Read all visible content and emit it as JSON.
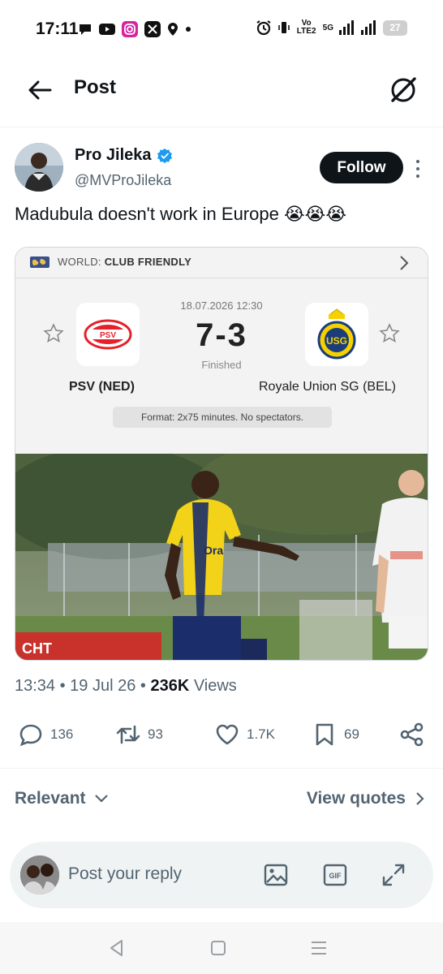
{
  "status_bar": {
    "time": "17:11",
    "network_label": "Vo LTE2",
    "signal_label": "5G",
    "battery": "27"
  },
  "header": {
    "title": "Post"
  },
  "post": {
    "author_name": "Pro Jileka",
    "author_handle": "@MVProJileka",
    "follow_label": "Follow",
    "text": "Madubula doesn't work in Europe 😭😭😭",
    "timestamp": "13:34 • 19 Jul 26 • ",
    "views_count": "236K",
    "views_label": " Views"
  },
  "match_card": {
    "competition_prefix": "WORLD: ",
    "competition_name": "CLUB FRIENDLY",
    "date": "18.07.2026 12:30",
    "score": "7-3",
    "status": "Finished",
    "home_team": "PSV (NED)",
    "away_team": "Royale Union SG (BEL)",
    "home_logo_text": "PSV",
    "away_logo_text": "USG",
    "format_note": "Format: 2x75 minutes. No spectators."
  },
  "photo_text": {
    "sponsor": "Ora",
    "banner": "CHT"
  },
  "actions": {
    "replies": "136",
    "reposts": "93",
    "likes": "1.7K",
    "bookmarks": "69"
  },
  "replies_section": {
    "sort_label": "Relevant",
    "quotes_label": "View quotes"
  },
  "reply_bar": {
    "placeholder": "Post your reply",
    "gif_label": "GIF"
  },
  "colors": {
    "accent": "#1d9bf0",
    "text_primary": "#0f1419",
    "text_secondary": "#536471",
    "usg_yellow": "#f5d100",
    "psv_red": "#e5202b"
  },
  "icons": {
    "back": "arrow-left-icon",
    "grok": "grok-icon",
    "reply": "comment-icon",
    "repost": "repost-icon",
    "like": "heart-icon",
    "bookmark": "bookmark-icon",
    "share": "share-icon"
  }
}
